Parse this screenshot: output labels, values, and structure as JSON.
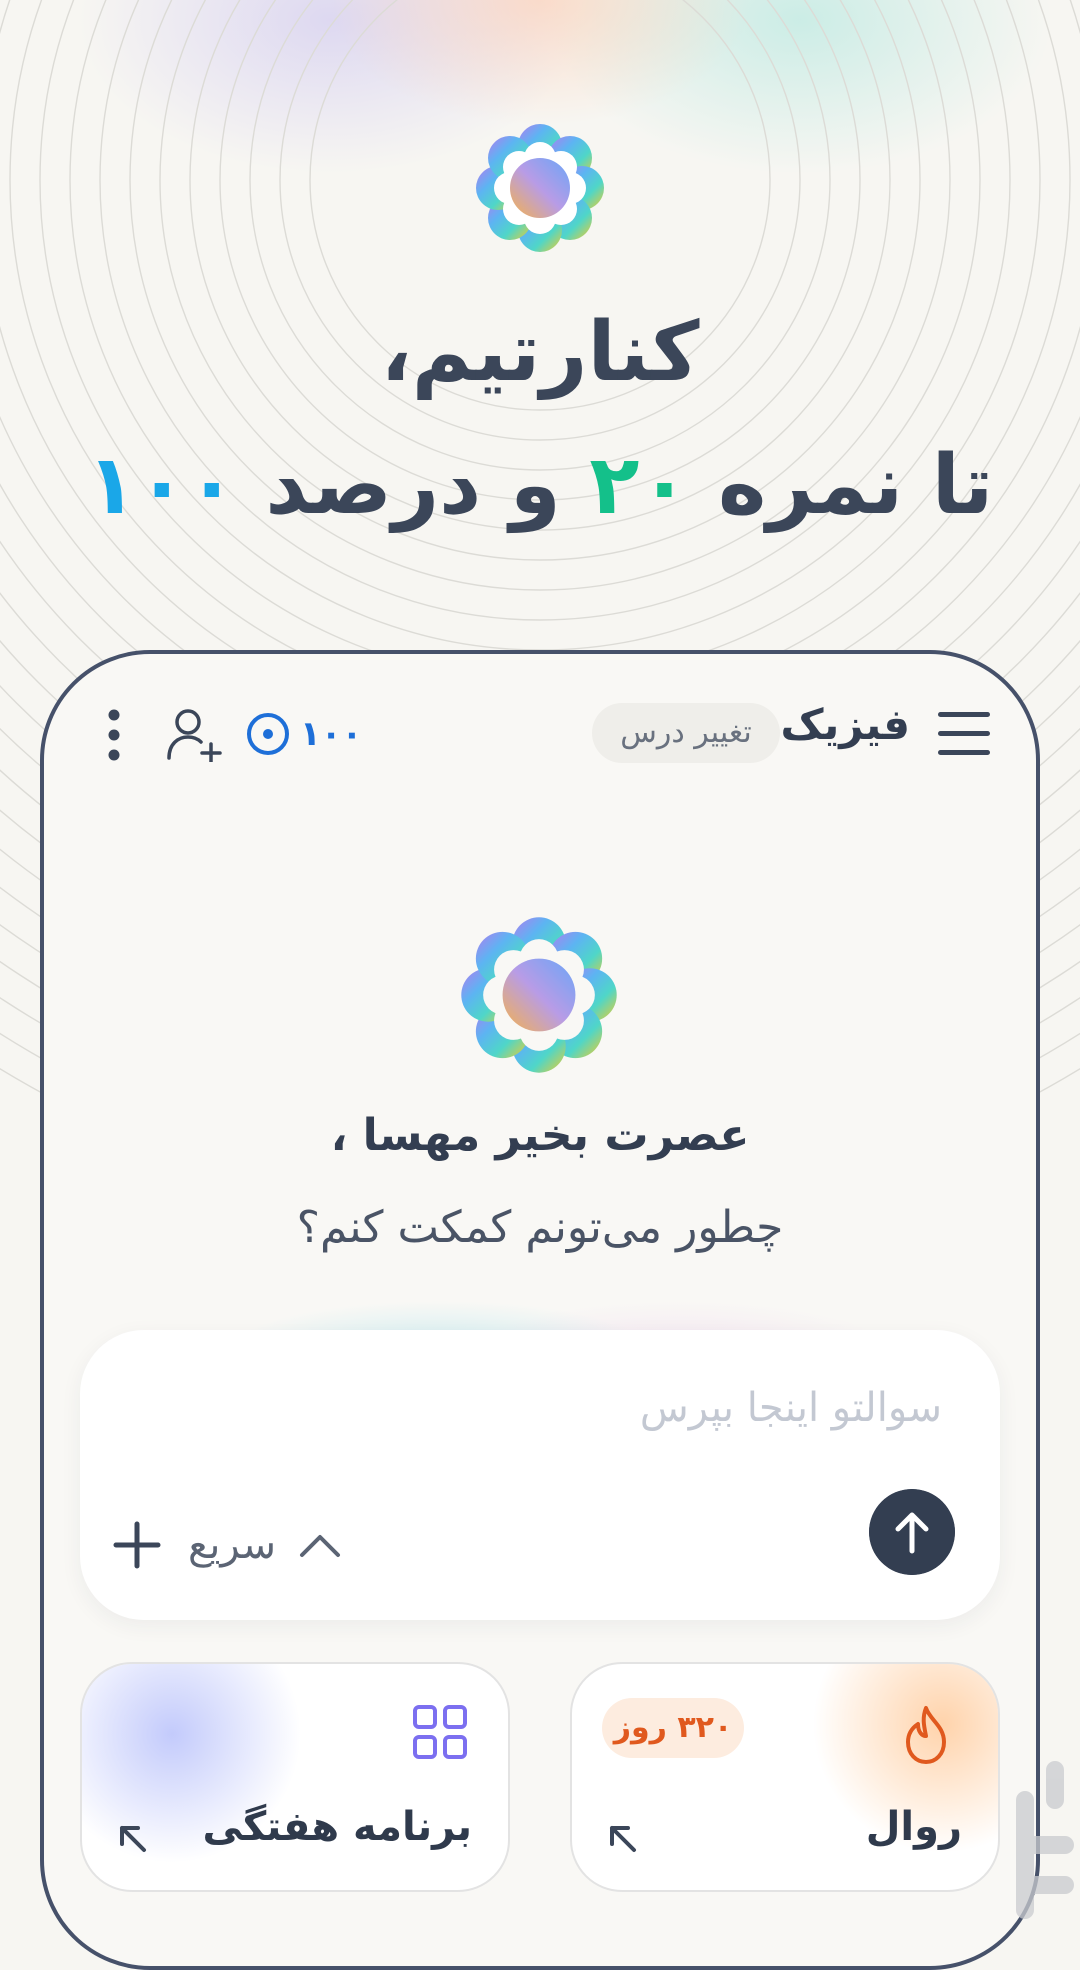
{
  "hero": {
    "line1": "کنارتیم،",
    "line2_prefix": "تا نمره",
    "line2_grade": "۲۰",
    "line2_mid": "و درصد",
    "line2_percent": "۱۰۰"
  },
  "header": {
    "subject": "فیزیک",
    "change_subject": "تغییر درس",
    "coins": "۱۰۰"
  },
  "chat": {
    "greeting": "عصرت بخیر مهسا ،",
    "prompt": "چطور می‌تونم کمکت کنم؟"
  },
  "input": {
    "placeholder": "سوالتو اینجا بپرس",
    "quick_label": "سریع"
  },
  "cards": {
    "weekly": {
      "title": "برنامه هفتگی",
      "icon": "grid-icon"
    },
    "streak": {
      "title": "روال",
      "badge": "۳۲۰ روز",
      "icon": "flame-icon"
    }
  },
  "colors": {
    "text_dark": "#333e51",
    "accent_green": "#14c08a",
    "accent_blue": "#1aa7e8",
    "coin_blue": "#1e6fd8",
    "streak_orange": "#e0591e",
    "grid_purple": "#7c6ff0"
  }
}
